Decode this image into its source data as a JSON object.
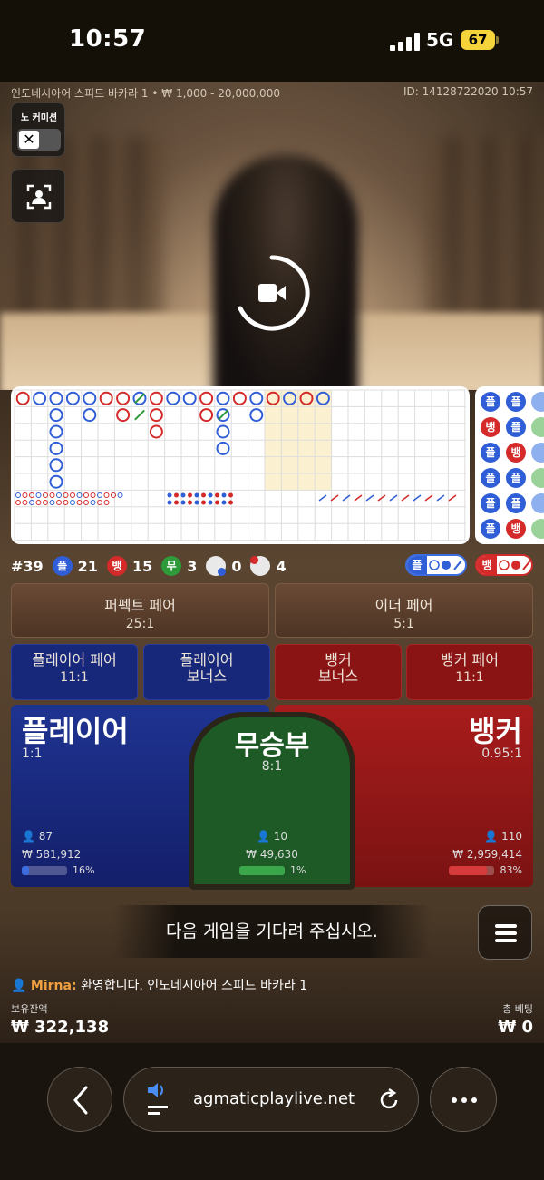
{
  "status_bar": {
    "time": "10:57",
    "network": "5G",
    "battery": "67"
  },
  "game": {
    "info": "인도네시아어 스피드 바카라 1 • ₩ 1,000 - 20,000,000",
    "round_id": "ID: 14128722020 10:57",
    "no_commission_label": "노 커미션",
    "no_commission_toggle": "✕"
  },
  "roadmap": {
    "bead_letters": {
      "player": "플",
      "banker": "뱅"
    },
    "bead_rows": [
      [
        "플",
        "플"
      ],
      [
        "뱅",
        "플"
      ],
      [
        "플",
        "뱅"
      ],
      [
        "플",
        "플"
      ],
      [
        "플",
        "플"
      ],
      [
        "플",
        "뱅"
      ]
    ]
  },
  "stats": {
    "round": "#39",
    "player_label": "플",
    "player_count": "21",
    "banker_label": "뱅",
    "banker_count": "15",
    "tie_label": "무",
    "tie_count": "3",
    "player_pair_count": "0",
    "banker_pair_count": "4",
    "predict_player": "플",
    "predict_banker": "뱅"
  },
  "colors": {
    "player": "#2f5ed6",
    "banker": "#d42a2a",
    "tie": "#2e9a3a"
  },
  "bets": {
    "perfect_pair": {
      "label": "퍼펙트 페어",
      "odds": "25:1"
    },
    "either_pair": {
      "label": "이더 페어",
      "odds": "5:1"
    },
    "player_pair": {
      "label": "플레이어 페어",
      "odds": "11:1"
    },
    "player_bonus": {
      "label1": "플레이어",
      "label2": "보너스"
    },
    "banker_bonus": {
      "label1": "뱅커",
      "label2": "보너스"
    },
    "banker_pair": {
      "label": "뱅커 페어",
      "odds": "11:1"
    },
    "player": {
      "label": "플레이어",
      "odds": "1:1",
      "players": "87",
      "amount": "₩ 581,912",
      "percent": "16%",
      "fill": 0.16
    },
    "tie": {
      "label": "무승부",
      "odds": "8:1",
      "players": "10",
      "amount": "₩ 49,630",
      "percent": "1%",
      "fill": 0.01
    },
    "banker": {
      "label": "뱅커",
      "odds": "0.95:1",
      "players": "110",
      "amount": "₩ 2,959,414",
      "percent": "83%",
      "fill": 0.83
    }
  },
  "message": "다음 게임을 기다려 주십시오.",
  "chat": {
    "user": "Mirna:",
    "text": "환영합니다. 인도네시아어 스피드 바카라 1"
  },
  "balance": {
    "label": "보유잔액",
    "value": "₩ 322,138"
  },
  "total_bet": {
    "label": "총 베팅",
    "value": "₩ 0"
  },
  "browser": {
    "url": "agmaticplaylive.net"
  }
}
